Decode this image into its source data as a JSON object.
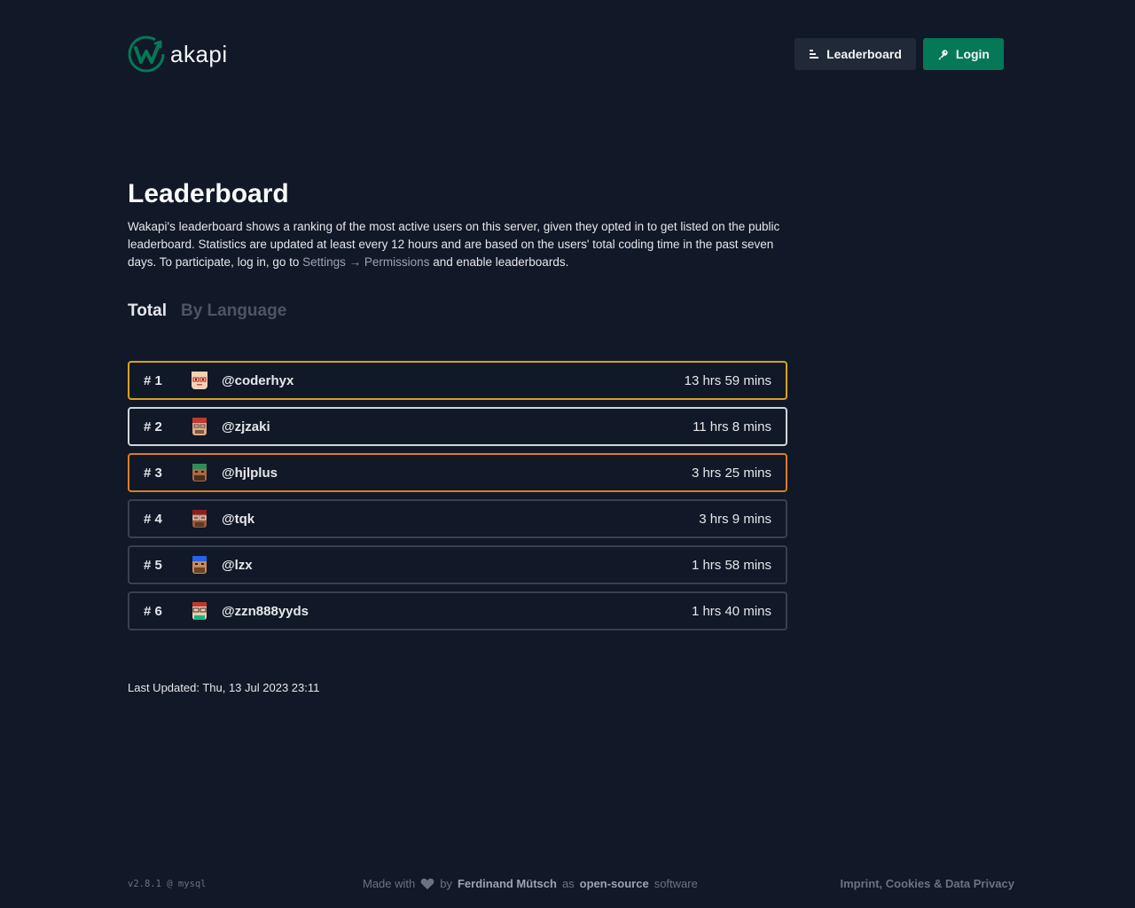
{
  "header": {
    "logo_text": "akapi",
    "nav": {
      "leaderboard_label": "Leaderboard",
      "login_label": "Login"
    }
  },
  "main": {
    "title": "Leaderboard",
    "intro_part1": "Wakapi's leaderboard shows a ranking of the most active users on this server, given they opted in to get listed on the public leaderboard. Statistics are updated at least every 12 hours and are based on the users' total coding time in the past seven days. To participate, log in, go to ",
    "intro_link_settings": "Settings",
    "intro_arrow": " → ",
    "intro_link_permissions": "Permissions",
    "intro_part2": " and enable leaderboards.",
    "tabs": [
      {
        "label": "Total",
        "active": true
      },
      {
        "label": "By Language",
        "active": false
      }
    ],
    "leaderboard": [
      {
        "rank": "# 1",
        "user": "@coderhyx",
        "time": "13 hrs 59 mins"
      },
      {
        "rank": "# 2",
        "user": "@zjzaki",
        "time": "11 hrs 8 mins"
      },
      {
        "rank": "# 3",
        "user": "@hjlplus",
        "time": "3 hrs 25 mins"
      },
      {
        "rank": "# 4",
        "user": "@tqk",
        "time": "3 hrs 9 mins"
      },
      {
        "rank": "# 5",
        "user": "@lzx",
        "time": "1 hrs 58 mins"
      },
      {
        "rank": "# 6",
        "user": "@zzn888yyds",
        "time": "1 hrs 40 mins"
      }
    ],
    "last_updated": "Last Updated: Thu, 13 Jul 2023 23:11"
  },
  "footer": {
    "version": "v2.8.1 @ mysql",
    "made_with": "Made with",
    "by": "by",
    "author": "Ferdinand Mütsch",
    "as": "as",
    "open_source": "open-source",
    "software": "software",
    "imprint": "Imprint, Cookies & Data Privacy"
  },
  "colors": {
    "background": "#111827",
    "accent_green": "#047857",
    "gold": "#d8a31d",
    "silver": "#d1d5db",
    "bronze": "#d97f26"
  },
  "icons": {
    "leaderboard_button": "list-icon",
    "login_button": "key-icon",
    "footer_heart": "heart-icon"
  }
}
